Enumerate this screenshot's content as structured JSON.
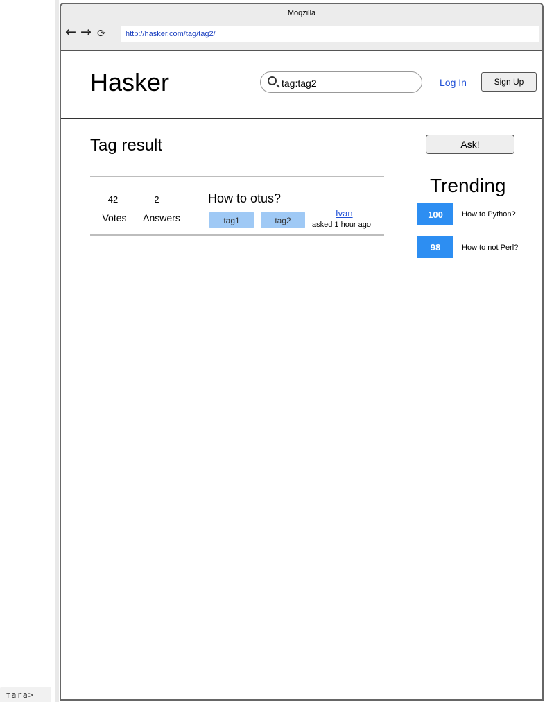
{
  "window": {
    "title": "Moqzilla",
    "url": "http://hasker.com/tag/tag2/"
  },
  "header": {
    "logo": "Hasker",
    "search_value": "tag:tag2",
    "login_label": "Log In",
    "signup_label": "Sign Up"
  },
  "main": {
    "page_title": "Tag result",
    "ask_label": "Ask!",
    "questions": [
      {
        "votes": "42",
        "votes_label": "Votes",
        "answers": "2",
        "answers_label": "Answers",
        "title": "How to otus?",
        "tags": [
          "tag1",
          "tag2"
        ],
        "author": "Ivan",
        "asked": "asked 1 hour ago"
      }
    ]
  },
  "trending": {
    "title": "Trending",
    "items": [
      {
        "votes": "100",
        "title": "How to Python?"
      },
      {
        "votes": "98",
        "title": "How to not Perl?"
      }
    ]
  },
  "stray_text": "таrа>",
  "colors": {
    "link": "#1f4fd6",
    "tag_chip": "#9fc9f5",
    "trend_badge": "#2d8ef2",
    "url_text": "#1a3fbf"
  },
  "icons": {
    "back": "arrow-left-icon",
    "forward": "arrow-right-icon",
    "reload": "reload-icon",
    "search": "search-icon"
  }
}
